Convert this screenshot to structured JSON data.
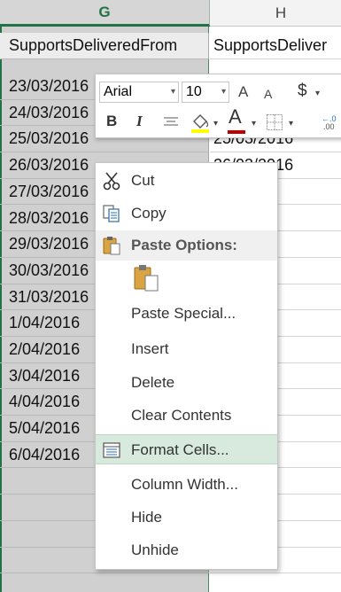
{
  "columns": {
    "g": "G",
    "h": "H"
  },
  "header_row": {
    "g": "SupportsDeliveredFrom",
    "h": "SupportsDeliver"
  },
  "g_cells": [
    "23/03/2016",
    "24/03/2016",
    "25/03/2016",
    "26/03/2016",
    "27/03/2016",
    "28/03/2016",
    "29/03/2016",
    "30/03/2016",
    "31/03/2016",
    "1/04/2016",
    "2/04/2016",
    "3/04/2016",
    "4/04/2016",
    "5/04/2016",
    "6/04/2016"
  ],
  "h_cells": [
    "",
    "",
    "25/03/2016",
    "26/03/2016",
    "016",
    "016",
    "016",
    "016",
    "016",
    "16",
    "16",
    "16",
    "16",
    "16",
    "16"
  ],
  "mini_toolbar": {
    "font": "Arial",
    "size": "10",
    "grow_font": "A",
    "shrink_font": "A",
    "currency": "$",
    "bold": "B",
    "italic": "I",
    "font_color_letter": "A",
    "font_color": "#c00000",
    "fill_color": "#ffff00"
  },
  "menu": {
    "cut": "Cut",
    "copy": "Copy",
    "paste_options": "Paste Options:",
    "paste_special": "Paste Special...",
    "insert": "Insert",
    "delete": "Delete",
    "clear_contents": "Clear Contents",
    "format_cells": "Format Cells...",
    "column_width": "Column Width...",
    "hide": "Hide",
    "unhide": "Unhide"
  },
  "colors": {
    "accent": "#217346",
    "selection": "#d0d0d0",
    "menu_highlight": "#d7eadd"
  }
}
